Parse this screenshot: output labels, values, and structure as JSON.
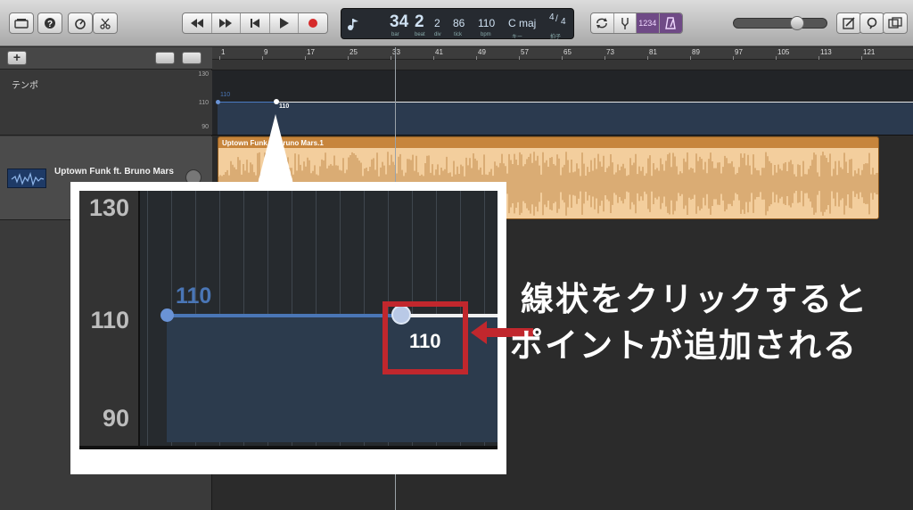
{
  "toolbar": {
    "lcd": {
      "bar": "34",
      "beat": "2",
      "div": "2",
      "tick": "86",
      "bpm": "110",
      "key": "C maj",
      "sig_top": "4",
      "sig_bottom": "4",
      "cap_bar": "bar",
      "cap_beat": "beat",
      "cap_div": "div",
      "cap_tick": "tick",
      "cap_bpm": "bpm",
      "cap_key": "キー",
      "cap_sig": "拍子"
    },
    "count_in": "1234",
    "volume_level": 0.7
  },
  "ruler": {
    "bars": [
      "1",
      "9",
      "17",
      "25",
      "33",
      "41",
      "49",
      "57",
      "65",
      "73",
      "81",
      "89",
      "97",
      "105",
      "113",
      "121"
    ]
  },
  "tempo_track": {
    "label": "テンポ",
    "ticks": [
      "130",
      "110",
      "90"
    ],
    "start_value": "110",
    "point_value": "110"
  },
  "audio_track": {
    "name": "Uptown Funk ft. Bruno Mars",
    "region_title": "Uptown Funk ft. Bruno Mars.1"
  },
  "zoom": {
    "ticks": [
      "130",
      "110",
      "90"
    ],
    "start_value": "110",
    "point_value": "110"
  },
  "annotation": {
    "line1": "線状をクリックすると",
    "line2": "ポイントが追加される"
  },
  "colors": {
    "accent_red": "#c1272d",
    "tempo_blue": "#4a76b6",
    "region_orange": "#c7853c"
  }
}
